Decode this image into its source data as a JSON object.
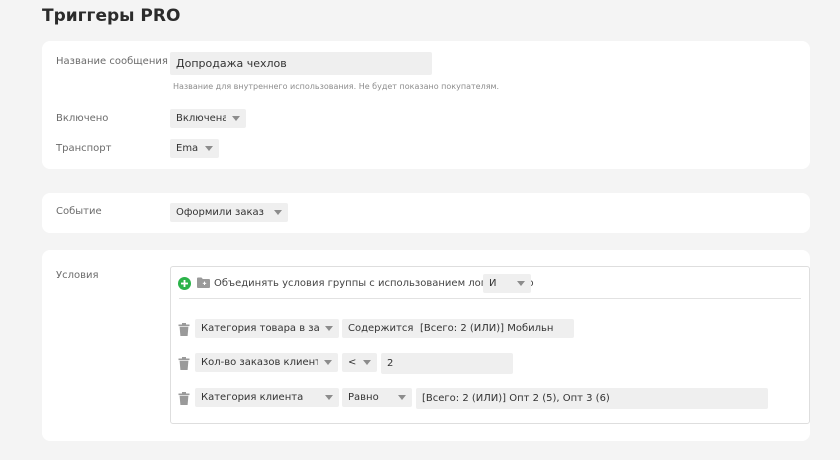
{
  "page": {
    "title": "Триггеры PRO"
  },
  "message": {
    "name_label": "Название сообщения",
    "name_value": "Допродажа чехлов",
    "name_hint": "Название для внутреннего использования. Не будет показано покупателям.",
    "enabled_label": "Включено",
    "enabled_value": "Включена",
    "transport_label": "Транспорт",
    "transport_value": "Email"
  },
  "event": {
    "label": "Событие",
    "value": "Оформили заказ"
  },
  "conditions": {
    "label": "Условия",
    "group_text": "Объединять условия группы с использованием логического",
    "logic_value": "И",
    "rows": [
      {
        "field": "Категория товара в заказе",
        "operator": "Содержится",
        "value": "[Всего: 2 (ИЛИ)] Мобильн"
      },
      {
        "field": "Кол-во заказов клиента",
        "operator": "<",
        "value": "2"
      },
      {
        "field": "Категория клиента",
        "operator": "Равно",
        "value": "[Всего: 2 (ИЛИ)] Опт 2 (5), Опт 3 (6)"
      }
    ]
  },
  "colors": {
    "add_icon": "#2bb34a",
    "page_bg": "#f4f4f4",
    "card_bg": "#ffffff",
    "field_bg": "#efefef"
  }
}
